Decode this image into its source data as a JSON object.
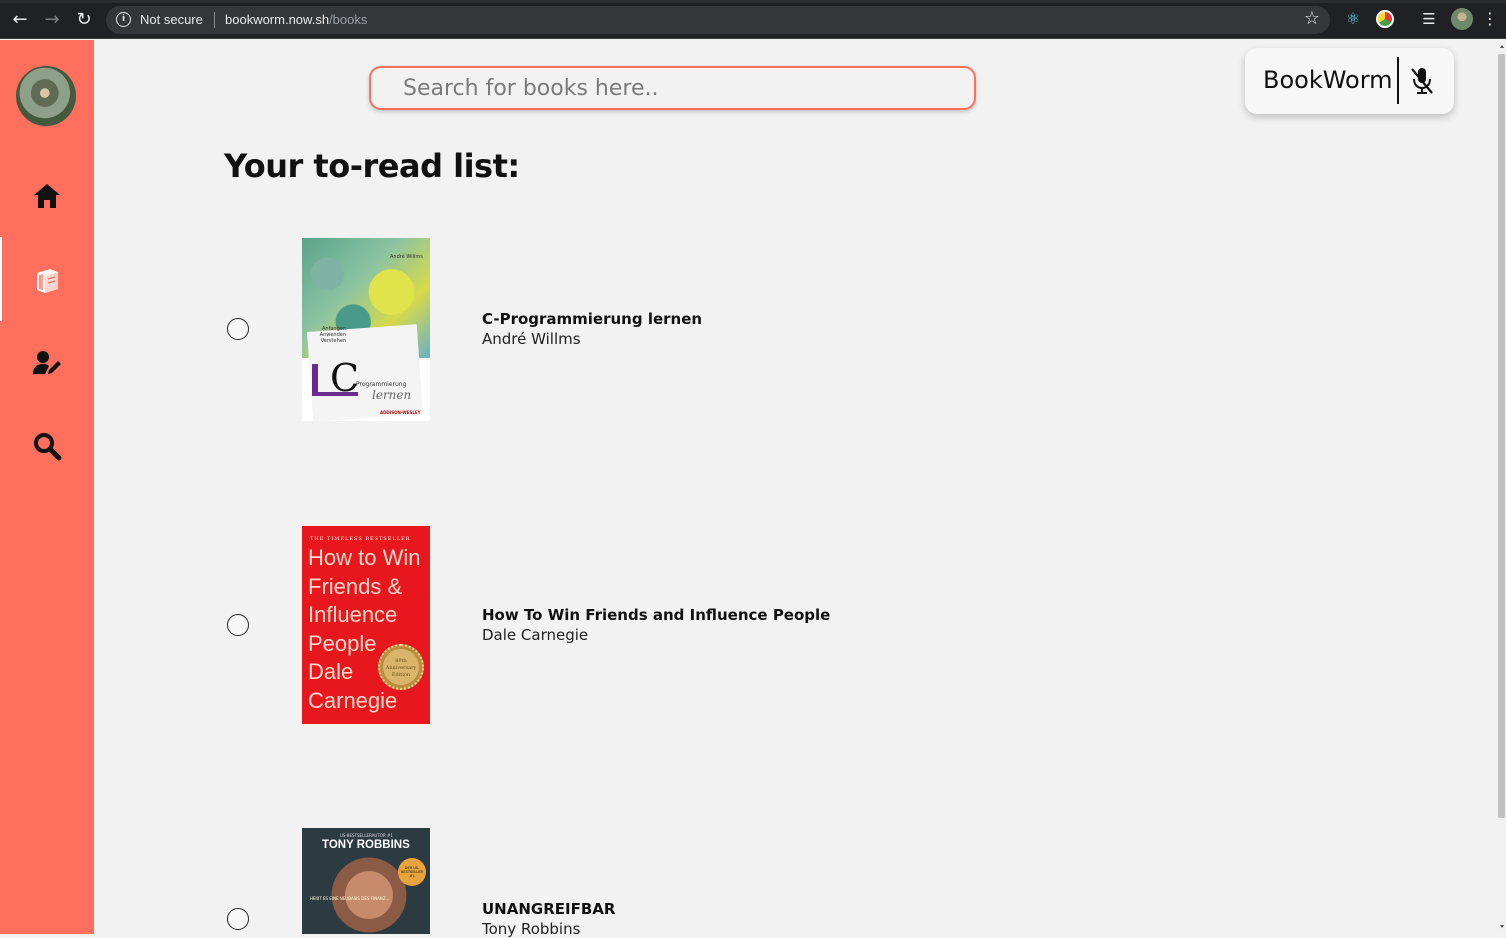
{
  "browser": {
    "secure_label": "Not secure",
    "url_host": "bookworm.now.sh",
    "url_path": "/books"
  },
  "sidebar": {
    "items": [
      {
        "icon": "home-icon"
      },
      {
        "icon": "books-icon",
        "active": true
      },
      {
        "icon": "user-edit-icon"
      },
      {
        "icon": "search-icon"
      }
    ],
    "accent": "#ff6f5e"
  },
  "search": {
    "placeholder": "Search for books here..",
    "value": ""
  },
  "brand": {
    "name": "BookWorm",
    "mic_icon": "mic-off-icon"
  },
  "page": {
    "heading": "Your to-read list:"
  },
  "books": [
    {
      "title": "C-Programmierung lernen",
      "author": "André Willms",
      "checked": false,
      "cover": {
        "author": "André Willms",
        "side_text": "Anfangen Anwenden Verstehen",
        "letter": "C",
        "line1": "Programmierung",
        "line2": "lernen",
        "publisher": "ADDISON-WESLEY"
      }
    },
    {
      "title": "How To Win Friends and Influence People",
      "author": "Dale Carnegie",
      "checked": false,
      "cover": {
        "tagline": "THE TIMELESS BESTSELLER",
        "lines": [
          "How to Win",
          "Friends &",
          "Influence",
          "People",
          "Dale",
          "Carnegie"
        ],
        "seal": "80th Anniversary Edition"
      }
    },
    {
      "title": "UNANGREIFBAR",
      "author": "Tony Robbins",
      "checked": false,
      "cover": {
        "toptag": "US-BESTSELLERAUTOR #1",
        "name": "TONY ROBBINS",
        "badge": "DER US-BESTSELLER #1",
        "sub": "HEIßT ES EINE NEUBASIS DES FINANZ..."
      }
    }
  ]
}
